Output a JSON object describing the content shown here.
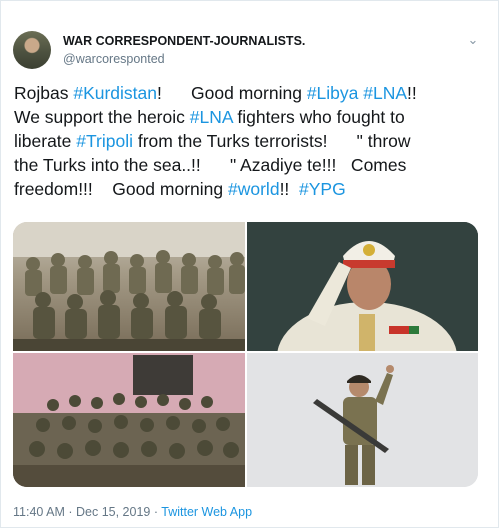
{
  "tweet": {
    "author_name": "WAR CORRESPONDENT-JOURNALISTS.",
    "author_handle": "@warcoresponted",
    "menu_icon": "chevron-down-icon",
    "lines": [
      [
        {
          "t": "Rojbas ",
          "tag": false
        },
        {
          "t": "#Kurdistan",
          "tag": true
        },
        {
          "t": "!      Good morning ",
          "tag": false
        },
        {
          "t": "#Libya",
          "tag": true
        },
        {
          "t": " ",
          "tag": false
        },
        {
          "t": "#LNA",
          "tag": true
        },
        {
          "t": "!!",
          "tag": false
        }
      ],
      [
        {
          "t": "We support the heroic ",
          "tag": false
        },
        {
          "t": "#LNA",
          "tag": true
        },
        {
          "t": " fighters who fought to",
          "tag": false
        }
      ],
      [
        {
          "t": "liberate ",
          "tag": false
        },
        {
          "t": "#Tripoli",
          "tag": true
        },
        {
          "t": " from the Turks terrorists!      \" throw",
          "tag": false
        }
      ],
      [
        {
          "t": "the Turks into the sea..!!      \" Azadiye te!!!   Comes",
          "tag": false
        }
      ],
      [
        {
          "t": "freedom!!!    Good morning ",
          "tag": false
        },
        {
          "t": "#world",
          "tag": true
        },
        {
          "t": "!!  ",
          "tag": false
        },
        {
          "t": "#YPG",
          "tag": true
        }
      ]
    ],
    "timestamp": "11:40 AM · Dec 15, 2019 · ",
    "source_app": "Twitter Web App"
  },
  "colors": {
    "link": "#1b95e0",
    "text": "#14171a",
    "secondary": "#657786"
  }
}
